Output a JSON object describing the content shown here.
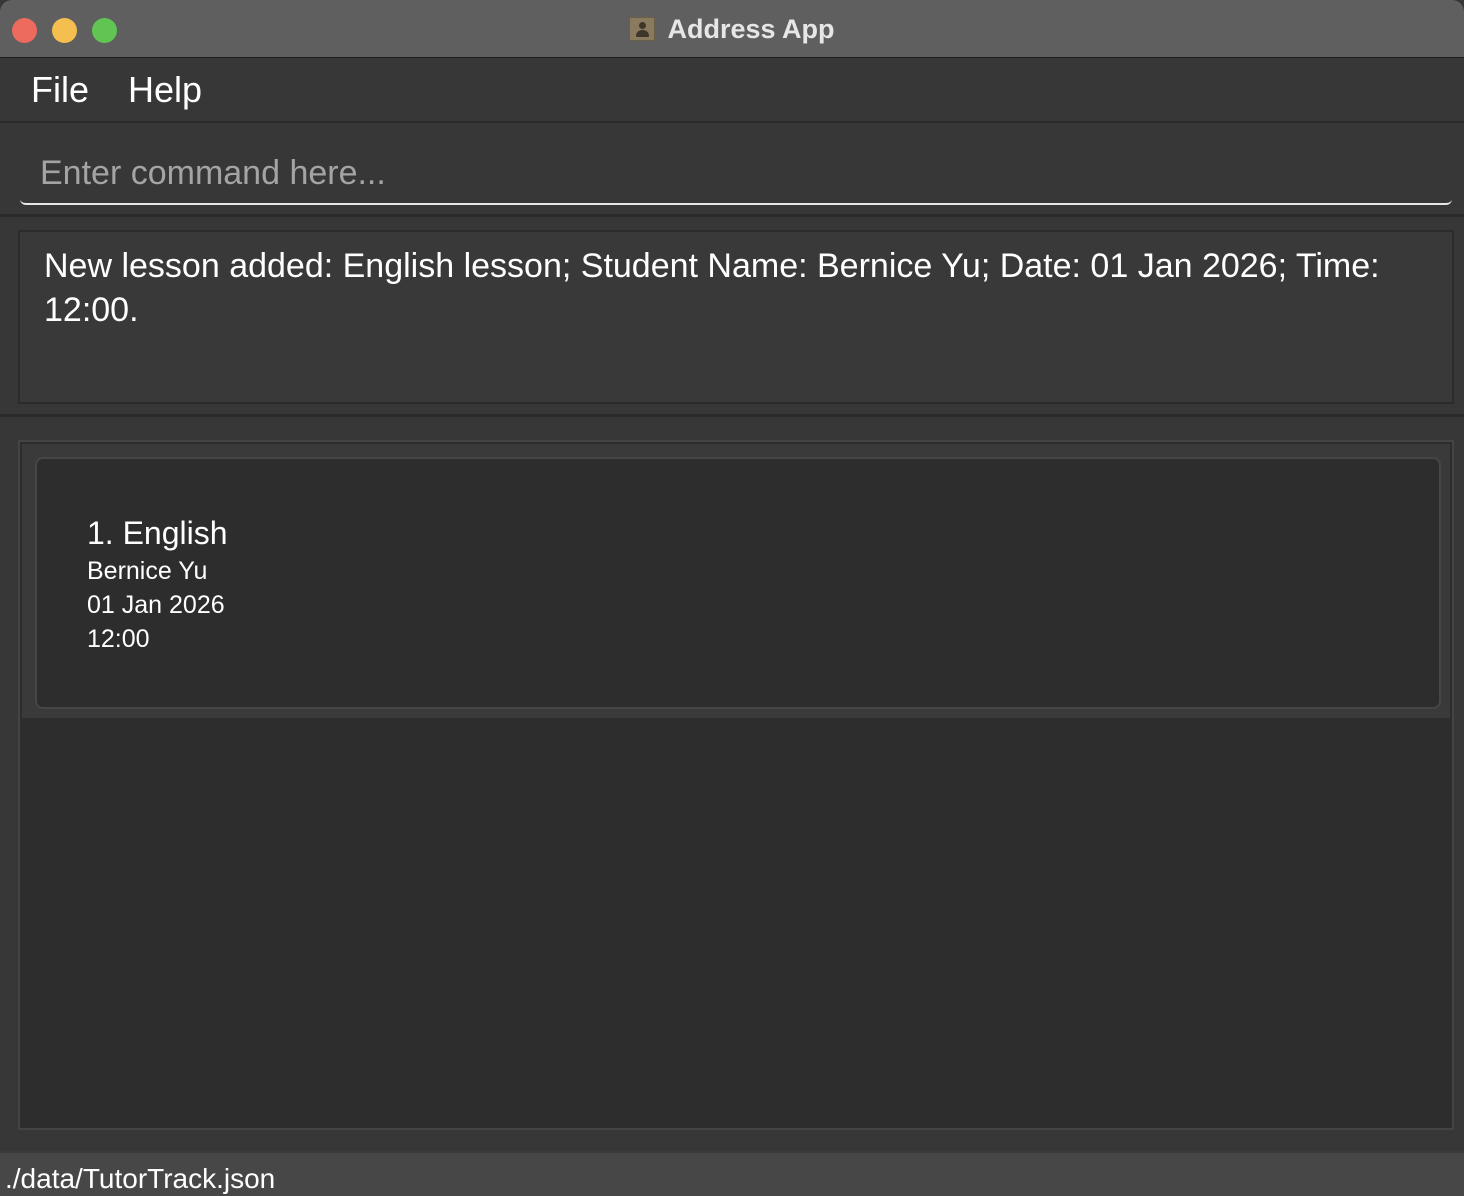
{
  "window": {
    "title": "Address App",
    "app_icon": "contact-book-icon"
  },
  "menu": {
    "items": [
      {
        "label": "File"
      },
      {
        "label": "Help"
      }
    ]
  },
  "command": {
    "placeholder": "Enter command here...",
    "value": ""
  },
  "result": {
    "text": "New lesson added: English lesson; Student Name: Bernice Yu; Date: 01 Jan 2026; Time: 12:00."
  },
  "lessons": [
    {
      "title": "1. English",
      "student": "Bernice Yu",
      "date": "01 Jan 2026",
      "time": "12:00"
    }
  ],
  "status": {
    "path": "./data/TutorTrack.json"
  },
  "colors": {
    "close": "#ed6a5e",
    "minimize": "#f5bf4f",
    "maximize": "#61c554"
  }
}
